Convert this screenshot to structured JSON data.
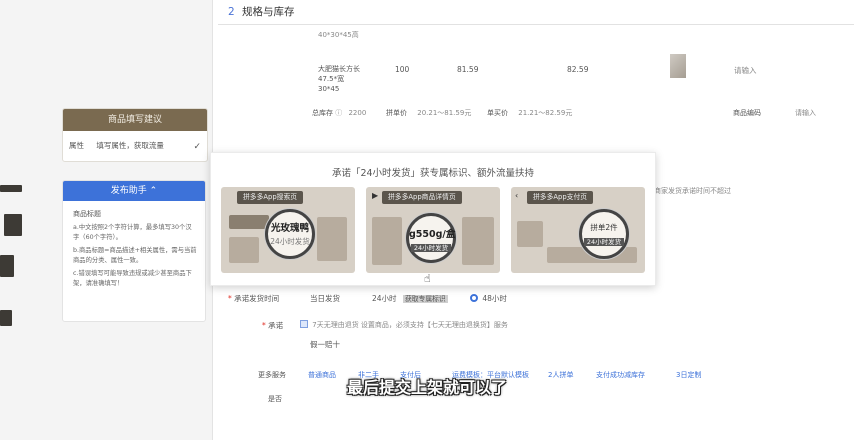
{
  "section": {
    "number": "2",
    "title": "规格与库存"
  },
  "rows": [
    {
      "spec": "40*30*45高"
    },
    {
      "spec_lines": [
        "大肥猫长方长",
        "47.5*宽",
        "30*45"
      ],
      "stock": "100",
      "group_price": "81.59",
      "single_price": "82.59",
      "sku_placeholder": "请输入"
    }
  ],
  "totals": {
    "stock_label": "总库存",
    "stock_value": "2200",
    "group_label": "拼单价",
    "group_range": "20.21～81.59元",
    "single_label": "单买价",
    "single_range": "21.21～82.59元",
    "code_label": "商品编码",
    "code_placeholder": "请输入"
  },
  "tip_card": {
    "header": "商品填写建议",
    "row_label": "属性",
    "row_value": "填写属性，获取流量"
  },
  "assistant": {
    "button": "发布助手 ⌃",
    "heading": "商品标题",
    "items": [
      "a.中文按照2个字符计算，最多填写30个汉字（60个字符）。",
      "b.商品标题=商品描述+相关属性，需与当前商品的分类、属性一致。",
      "c.错误填写可能导致违规或减少甚至商品下架，请准确填写！"
    ]
  },
  "popup": {
    "title": "承诺「24小时发货」获专属标识、额外流量扶持",
    "shots": [
      {
        "label": "拼多多App搜索页",
        "mag_main": "光玫瑰鸭",
        "mag_sub": "24小时发货"
      },
      {
        "label": "拼多多App商品详情页",
        "mag_main": "g550g/盒",
        "mag_sub": "24小时发货"
      },
      {
        "label": "拼多多App支付页",
        "mag_main": "拼单2件",
        "mag_sub": "24小时发货"
      }
    ]
  },
  "right_note": "商家发货承诺时间不超过",
  "shipping": {
    "label": "承诺发货时间",
    "option1": "当日发货",
    "option2": "24小时",
    "option2_tag": "获取专属标识",
    "option3": "48小时"
  },
  "promise": {
    "label": "承诺",
    "text": "7天无理由退货  设置商品，必须支持【七天无理由退换货】服务"
  },
  "fake_one": "假一赔十",
  "more": {
    "label": "更多服务",
    "items": [
      "普通商品",
      "非二手",
      "支付后",
      "运费模板：平台默认模板",
      "2人拼单",
      "支付成功减库存",
      "3日定制"
    ],
    "next": "是否"
  },
  "subtitle": "最后提交上架就可以了"
}
